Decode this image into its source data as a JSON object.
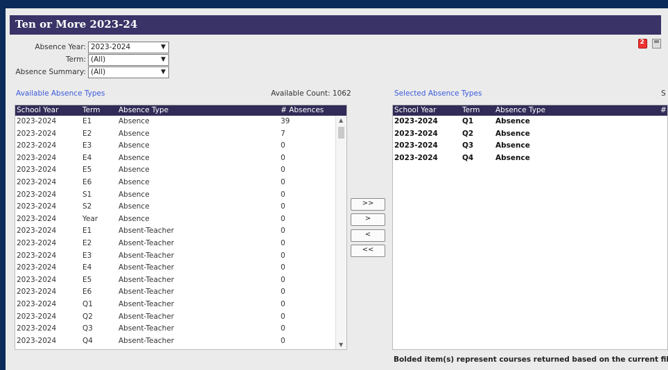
{
  "title": "Ten or More 2023-24",
  "filters": {
    "absence_year": {
      "label": "Absence Year:",
      "value": "2023-2024"
    },
    "term": {
      "label": "Term:",
      "value": "(All)"
    },
    "absence_summary": {
      "label": "Absence Summary:",
      "value": "(All)"
    }
  },
  "icons": {
    "refresh": "refresh-icon",
    "save": "save-icon"
  },
  "available": {
    "title": "Available Absence Types",
    "count_text": "Available Count: 1062",
    "columns": [
      "School Year",
      "Term",
      "Absence Type",
      "# Absences"
    ],
    "rows": [
      [
        "2023-2024",
        "E1",
        "Absence",
        "39"
      ],
      [
        "2023-2024",
        "E2",
        "Absence",
        "7"
      ],
      [
        "2023-2024",
        "E3",
        "Absence",
        "0"
      ],
      [
        "2023-2024",
        "E4",
        "Absence",
        "0"
      ],
      [
        "2023-2024",
        "E5",
        "Absence",
        "0"
      ],
      [
        "2023-2024",
        "E6",
        "Absence",
        "0"
      ],
      [
        "2023-2024",
        "S1",
        "Absence",
        "0"
      ],
      [
        "2023-2024",
        "S2",
        "Absence",
        "0"
      ],
      [
        "2023-2024",
        "Year",
        "Absence",
        "0"
      ],
      [
        "2023-2024",
        "E1",
        "Absent-Teacher",
        "0"
      ],
      [
        "2023-2024",
        "E2",
        "Absent-Teacher",
        "0"
      ],
      [
        "2023-2024",
        "E3",
        "Absent-Teacher",
        "0"
      ],
      [
        "2023-2024",
        "E4",
        "Absent-Teacher",
        "0"
      ],
      [
        "2023-2024",
        "E5",
        "Absent-Teacher",
        "0"
      ],
      [
        "2023-2024",
        "E6",
        "Absent-Teacher",
        "0"
      ],
      [
        "2023-2024",
        "Q1",
        "Absent-Teacher",
        "0"
      ],
      [
        "2023-2024",
        "Q2",
        "Absent-Teacher",
        "0"
      ],
      [
        "2023-2024",
        "Q3",
        "Absent-Teacher",
        "0"
      ],
      [
        "2023-2024",
        "Q4",
        "Absent-Teacher",
        "0"
      ]
    ]
  },
  "buttons": {
    "add_all": ">>",
    "add": ">",
    "remove": "<",
    "remove_all": "<<"
  },
  "selected": {
    "title": "Selected Absence Types",
    "count_text": "S",
    "columns": [
      "School Year",
      "Term",
      "Absence Type",
      "#"
    ],
    "rows": [
      [
        "2023-2024",
        "Q1",
        "Absence"
      ],
      [
        "2023-2024",
        "Q2",
        "Absence"
      ],
      [
        "2023-2024",
        "Q3",
        "Absence"
      ],
      [
        "2023-2024",
        "Q4",
        "Absence"
      ]
    ]
  },
  "footer": "Bolded item(s) represent courses returned based on the current filte"
}
